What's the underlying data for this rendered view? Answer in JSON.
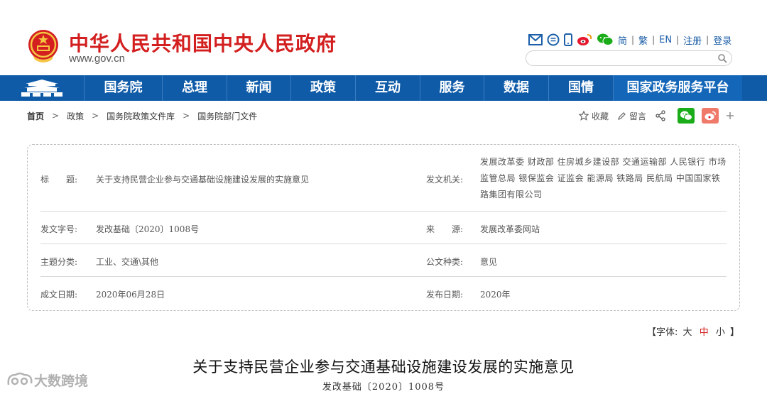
{
  "header": {
    "site_title": "中华人民共和国中央人民政府",
    "site_url": "www.gov.cn",
    "lang_links": [
      "简",
      "繁",
      "EN",
      "注册",
      "登录"
    ],
    "search_placeholder": ""
  },
  "nav": {
    "items": [
      "国务院",
      "总理",
      "新闻",
      "政策",
      "互动",
      "服务",
      "数据",
      "国情",
      "国家政务服务平台"
    ]
  },
  "breadcrumb": [
    "首页",
    "政策",
    "国务院政策文件库",
    "国务院部门文件"
  ],
  "share": {
    "favorite": "收藏",
    "comment": "留言"
  },
  "info": {
    "title_label": "标　　题:",
    "title_value": "关于支持民营企业参与交通基础设施建设发展的实施意见",
    "issuer_label": "发文机关:",
    "issuer_value": "发展改革委 财政部 住房城乡建设部 交通运输部 人民银行 市场监管总局 银保监会 证监会 能源局 铁路局 民航局 中国国家铁路集团有限公司",
    "docno_label": "发文字号:",
    "docno_value": "发改基础〔2020〕1008号",
    "source_label": "来　　源:",
    "source_value": "发展改革委网站",
    "category_label": "主题分类:",
    "category_value": "工业、交通\\其他",
    "doctype_label": "公文种类:",
    "doctype_value": "意见",
    "date_label": "成文日期:",
    "date_value": "2020年06月28日",
    "pubdate_label": "发布日期:",
    "pubdate_value": "2020年"
  },
  "fontsize": {
    "prefix": "【字体:",
    "large": "大",
    "medium": "中",
    "small": "小",
    "suffix": "】"
  },
  "document": {
    "title": "关于支持民营企业参与交通基础设施建设发展的实施意见",
    "number": "发改基础〔2020〕1008号"
  },
  "watermark": "大数跨境",
  "colors": {
    "brand_red": "#d31f1f",
    "nav_blue": "#0f5ba8",
    "wechat_green": "#1aad19",
    "weibo_red": "#e6162d"
  }
}
